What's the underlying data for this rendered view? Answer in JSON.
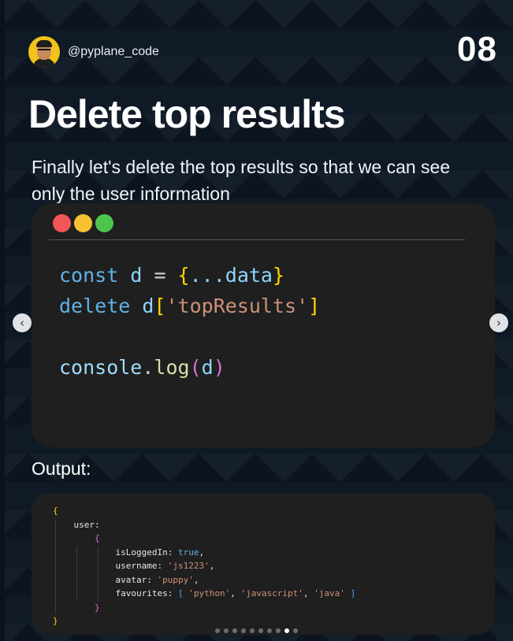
{
  "header": {
    "handle": "@pyplane_code",
    "slide_number": "08"
  },
  "title": "Delete top results",
  "subtitle": "Finally let's delete the top results so that we can see only the user information",
  "code": {
    "line1": {
      "kw": "const",
      "var": "d",
      "op": " = ",
      "open": "{",
      "spread": "...data",
      "close": "}"
    },
    "line2": {
      "kw": "delete",
      "var": "d",
      "open": "[",
      "str": "'topResults'",
      "close": "]"
    },
    "line3": {
      "obj": "console",
      "dot": ".",
      "fn": "log",
      "open": "(",
      "arg": "d",
      "close": ")"
    }
  },
  "output_label": "Output:",
  "output": {
    "open": "{",
    "user_key": "user:",
    "user_open": "{",
    "isLoggedIn_key": "isLoggedIn: ",
    "isLoggedIn_val": "true",
    "username_key": "username: ",
    "username_val": "'js1223'",
    "avatar_key": "avatar: ",
    "avatar_val": "'puppy'",
    "favourites_key": "favourites: ",
    "fav_open": "[",
    "fav_items": [
      "'python'",
      "'javascript'",
      "'java'"
    ],
    "fav_close": "]",
    "user_close": "}",
    "close": "}"
  },
  "pager": {
    "total": 10,
    "active_index": 8
  },
  "icons": {
    "prev": "chevron-left-icon",
    "next": "chevron-right-icon"
  },
  "colors": {
    "background": "#0f1a26",
    "window": "#1f1f1f",
    "dot_red": "#f25558",
    "dot_yellow": "#f6c330",
    "dot_green": "#4dc44d"
  }
}
